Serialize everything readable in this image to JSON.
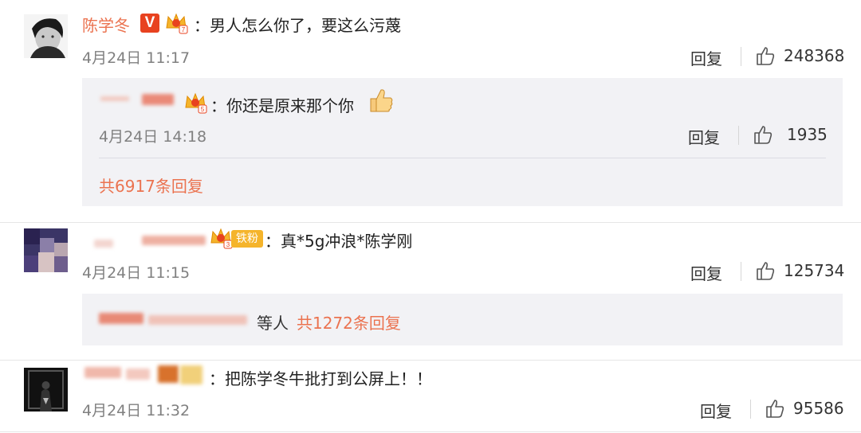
{
  "comments": [
    {
      "username": "陈学冬",
      "text": "：男人怎么你了，要这么污蔑",
      "time": "4月24日 11:17",
      "reply_label": "回复",
      "likes": "248368",
      "replies": [
        {
          "text": "：你还是原来那个你",
          "time": "4月24日 14:18",
          "reply_label": "回复",
          "likes": "1935"
        }
      ],
      "more_replies": "共6917条回复"
    },
    {
      "text": "：真*5g冲浪*陈学刚",
      "fan_badge": "铁粉",
      "time": "4月24日 11:15",
      "reply_label": "回复",
      "likes": "125734",
      "reply_summary_tail": "等人",
      "more_replies": "共1272条回复"
    },
    {
      "text": "：把陈学冬牛批打到公屏上！！",
      "time": "4月24日 11:32",
      "reply_label": "回复",
      "likes": "95586"
    }
  ],
  "colors": {
    "accent": "#eb7350",
    "muted": "#808080",
    "panel": "#f2f2f5",
    "vip": "#e8421f"
  },
  "icons": [
    "thumbs-up-icon",
    "crown-icon",
    "verified-v-icon",
    "thumbs-up-emoji"
  ]
}
